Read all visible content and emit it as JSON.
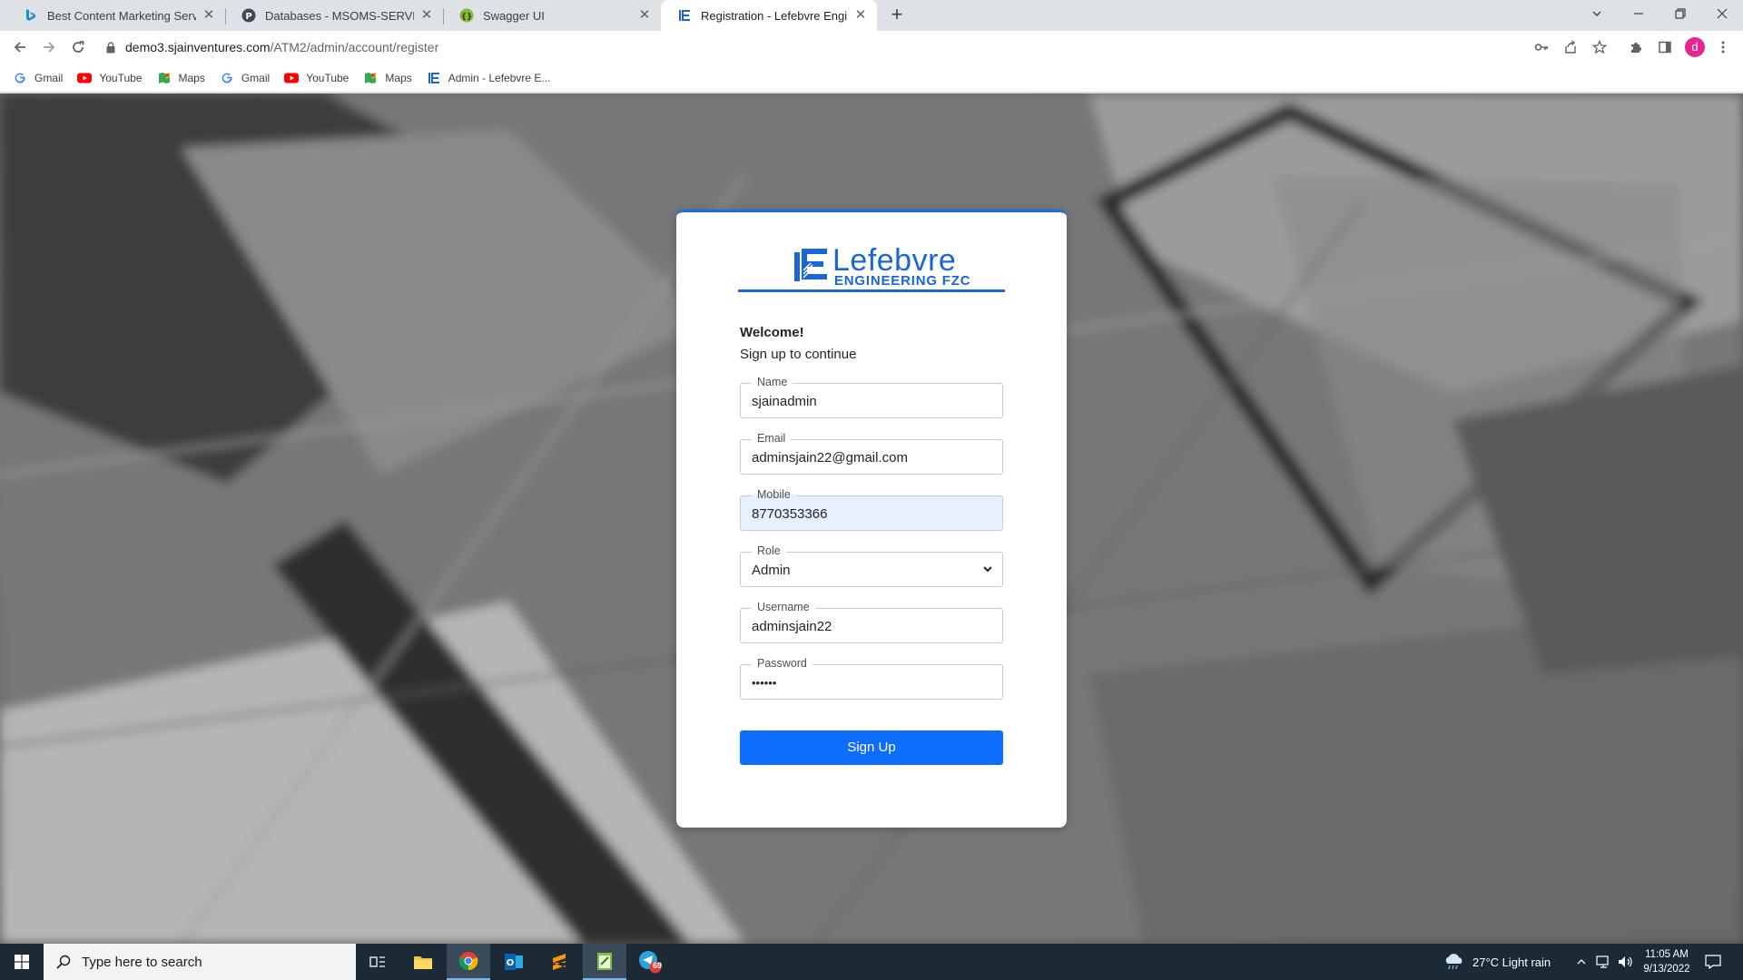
{
  "browser": {
    "tabs": [
      {
        "title": "Best Content Marketing Services",
        "icon": "bing-icon"
      },
      {
        "title": "Databases - MSOMS-SERVER",
        "icon": "pgadmin-icon"
      },
      {
        "title": "Swagger UI",
        "icon": "swagger-icon"
      },
      {
        "title": "Registration - Lefebvre Engineer",
        "icon": "lefebvre-icon",
        "active": true
      }
    ],
    "url_host": "demo3.sjainventures.com",
    "url_path": "/ATM2/admin/account/register",
    "profile_initial": "d",
    "bookmarks": [
      {
        "label": "Gmail",
        "icon": "google-icon"
      },
      {
        "label": "YouTube",
        "icon": "youtube-icon"
      },
      {
        "label": "Maps",
        "icon": "maps-icon"
      },
      {
        "label": "Gmail",
        "icon": "google-icon"
      },
      {
        "label": "YouTube",
        "icon": "youtube-icon"
      },
      {
        "label": "Maps",
        "icon": "maps-icon"
      },
      {
        "label": "Admin - Lefebvre E...",
        "icon": "lefebvre-icon"
      }
    ]
  },
  "page": {
    "logo": {
      "name": "Lefebvre",
      "sub": "ENGINEERING FZC"
    },
    "welcome": "Welcome!",
    "subtitle": "Sign up to continue",
    "form": {
      "name": {
        "label": "Name",
        "value": "sjainadmin"
      },
      "email": {
        "label": "Email",
        "value": "adminsjain22@gmail.com"
      },
      "mobile": {
        "label": "Mobile",
        "value": "8770353366"
      },
      "role": {
        "label": "Role",
        "value": "Admin"
      },
      "username": {
        "label": "Username",
        "value": "adminsjain22"
      },
      "password": {
        "label": "Password",
        "value": "••••••"
      }
    },
    "submit_label": "Sign Up",
    "colors": {
      "accent": "#0d6efd",
      "brand": "#1a66d9"
    }
  },
  "taskbar": {
    "search_placeholder": "Type here to search",
    "weather": "27°C  Light rain",
    "time": "11:05 AM",
    "date": "9/13/2022",
    "badge_count": "69"
  }
}
